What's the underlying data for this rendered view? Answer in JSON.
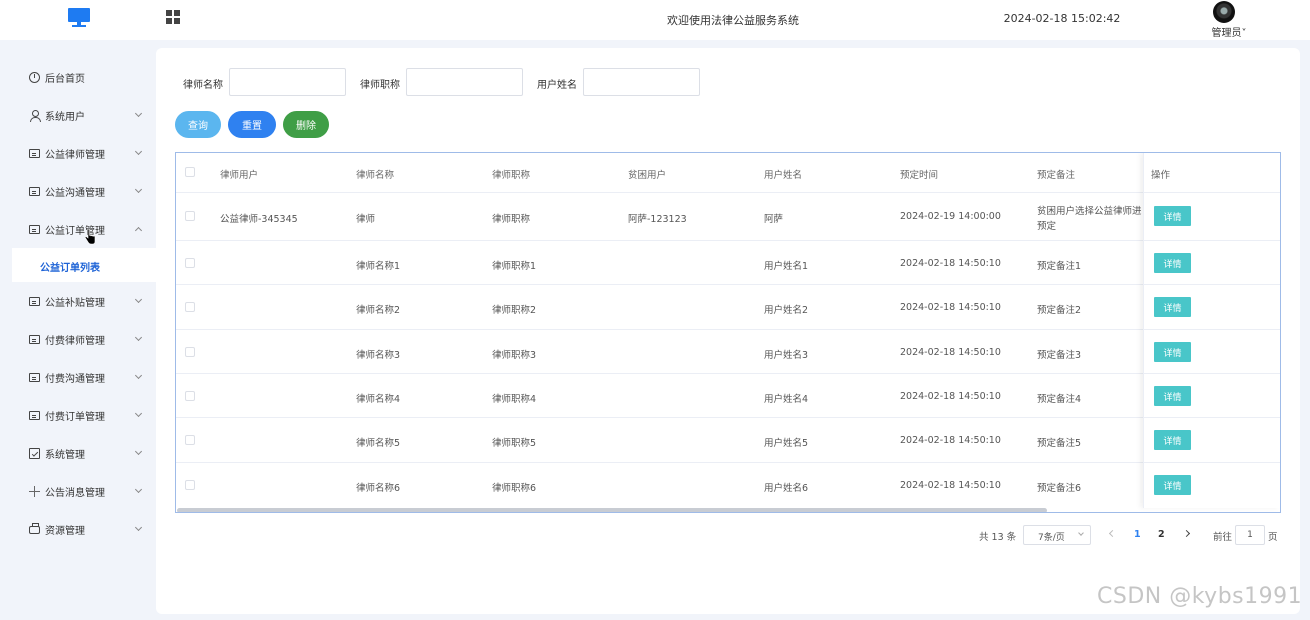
{
  "header": {
    "title": "欢迎使用法律公益服务系统",
    "datetime": "2024-02-18 15:02:42",
    "user_name": "管理员˅",
    "logo_icon": "monitor-icon",
    "menu_toggle_icon": "grid-icon"
  },
  "sidebar": {
    "items": [
      {
        "label": "后台首页",
        "icon": "clock-icon"
      },
      {
        "label": "系统用户",
        "icon": "user-icon"
      },
      {
        "label": "公益律师管理",
        "icon": "card-icon"
      },
      {
        "label": "公益沟通管理",
        "icon": "card-icon"
      },
      {
        "label": "公益订单管理",
        "icon": "card-icon"
      },
      {
        "label": "公益补贴管理",
        "icon": "card-icon"
      },
      {
        "label": "付费律师管理",
        "icon": "card-icon"
      },
      {
        "label": "付费沟通管理",
        "icon": "card-icon"
      },
      {
        "label": "付费订单管理",
        "icon": "card-icon"
      },
      {
        "label": "系统管理",
        "icon": "box-icon"
      },
      {
        "label": "公告消息管理",
        "icon": "sparkle-icon"
      },
      {
        "label": "资源管理",
        "icon": "printer-icon"
      }
    ],
    "active_submenu": "公益订单列表"
  },
  "search": {
    "lawyer_name_label": "律师名称",
    "lawyer_title_label": "律师职称",
    "user_name_label": "用户姓名",
    "lawyer_name_value": "",
    "lawyer_title_value": "",
    "user_name_value": ""
  },
  "actions": {
    "search_label": "查询",
    "reset_label": "重置",
    "delete_label": "删除"
  },
  "table": {
    "columns": [
      "律师用户",
      "律师名称",
      "律师职称",
      "贫困用户",
      "用户姓名",
      "预定时间",
      "预定备注",
      "操作"
    ],
    "detail_label": "详情",
    "rows": [
      {
        "lawyer_user": "公益律师-345345",
        "lawyer_name": "律师",
        "lawyer_title": "律师职称",
        "poor_user": "阿萨-123123",
        "user_name": "阿萨",
        "time": "2024-02-19 14:00:00",
        "note_line1": "贫困用户选择公益律师进",
        "note_line2": "预定"
      },
      {
        "lawyer_user": "",
        "lawyer_name": "律师名称1",
        "lawyer_title": "律师职称1",
        "poor_user": "",
        "user_name": "用户姓名1",
        "time": "2024-02-18 14:50:10",
        "note_line1": "预定备注1",
        "note_line2": ""
      },
      {
        "lawyer_user": "",
        "lawyer_name": "律师名称2",
        "lawyer_title": "律师职称2",
        "poor_user": "",
        "user_name": "用户姓名2",
        "time": "2024-02-18 14:50:10",
        "note_line1": "预定备注2",
        "note_line2": ""
      },
      {
        "lawyer_user": "",
        "lawyer_name": "律师名称3",
        "lawyer_title": "律师职称3",
        "poor_user": "",
        "user_name": "用户姓名3",
        "time": "2024-02-18 14:50:10",
        "note_line1": "预定备注3",
        "note_line2": ""
      },
      {
        "lawyer_user": "",
        "lawyer_name": "律师名称4",
        "lawyer_title": "律师职称4",
        "poor_user": "",
        "user_name": "用户姓名4",
        "time": "2024-02-18 14:50:10",
        "note_line1": "预定备注4",
        "note_line2": ""
      },
      {
        "lawyer_user": "",
        "lawyer_name": "律师名称5",
        "lawyer_title": "律师职称5",
        "poor_user": "",
        "user_name": "用户姓名5",
        "time": "2024-02-18 14:50:10",
        "note_line1": "预定备注5",
        "note_line2": ""
      },
      {
        "lawyer_user": "",
        "lawyer_name": "律师名称6",
        "lawyer_title": "律师职称6",
        "poor_user": "",
        "user_name": "用户姓名6",
        "time": "2024-02-18 14:50:10",
        "note_line1": "预定备注6",
        "note_line2": ""
      }
    ]
  },
  "pagination": {
    "total": "共 13 条",
    "page_size": "7条/页",
    "pages": [
      "1",
      "2"
    ],
    "current_page": "1",
    "goto_label": "前往",
    "goto_value": "1",
    "page_unit": "页",
    "active_color": "#2f81f0"
  },
  "watermark": "CSDN @kybs1991"
}
